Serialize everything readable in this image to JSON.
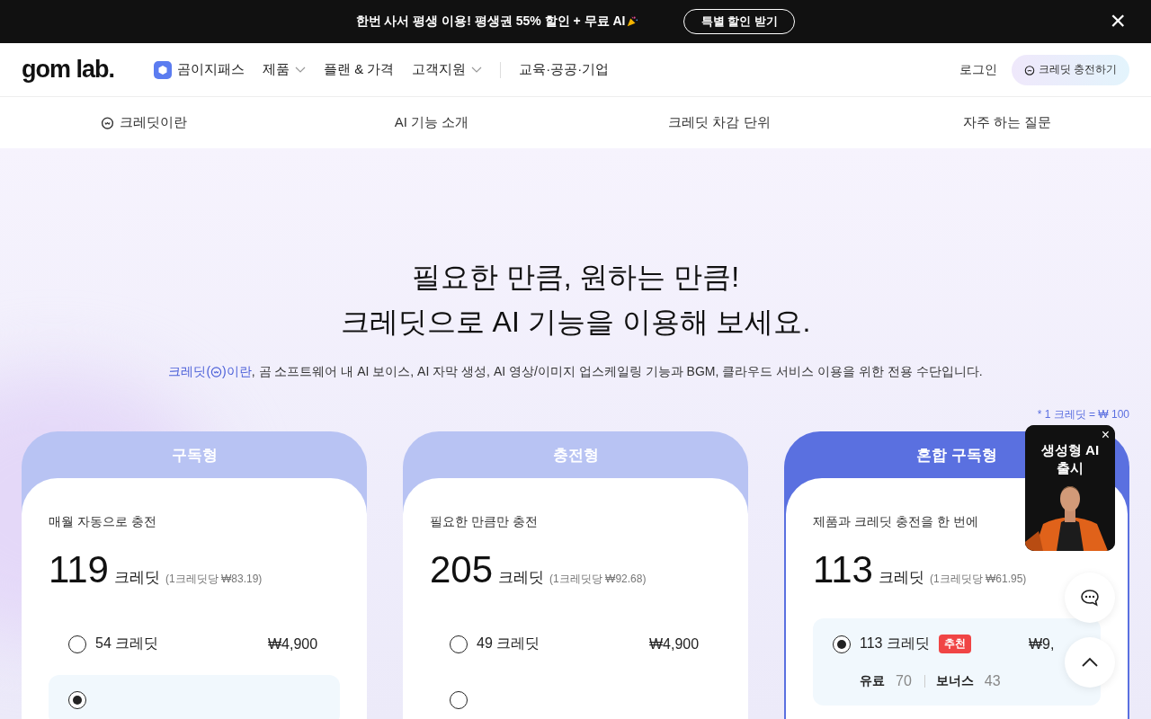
{
  "promo_bar": {
    "text": "한번 사서 평생 이용! 평생권 55% 할인 + 무료 AI",
    "button": "특별 할인 받기",
    "close": "×"
  },
  "nav": {
    "logo": "gom lab.",
    "items": [
      {
        "label": "곰이지패스",
        "kind": "pass"
      },
      {
        "label": "제품",
        "kind": "dropdown"
      },
      {
        "label": "플랜 & 가격",
        "kind": "plain"
      },
      {
        "label": "고객지원",
        "kind": "dropdown"
      },
      {
        "label": "교육·공공·기업",
        "kind": "divided"
      }
    ],
    "login": "로그인",
    "charge_button": "크레딧 충전하기"
  },
  "subnav": [
    {
      "label": "크레딧이란",
      "icon": true
    },
    {
      "label": "AI 기능 소개",
      "icon": false
    },
    {
      "label": "크레딧 차감 단위",
      "icon": false
    },
    {
      "label": "자주 하는 질문",
      "icon": false
    }
  ],
  "hero": {
    "title_lines": [
      "필요한 만큼, 원하는 만큼!",
      "크레딧으로 AI 기능을 이용해 보세요."
    ],
    "link_before": "크레딧(",
    "link_after": ")이란",
    "description": ", 곰 소프트웨어 내 AI 보이스, AI 자막 생성, AI 영상/이미지 업스케일링 기능과 BGM, 클라우드 서비스 이용을 위한 전용 수단입니다.",
    "note": "* 1 크레딧 = ₩ 100"
  },
  "plans": [
    {
      "title": "구독형",
      "selected": false,
      "subtitle": "매월 자동으로 충전",
      "amount": "119",
      "unit": "크레딧",
      "per": "(1크레딧당 ₩83.19)",
      "options": [
        {
          "label": "54 크레딧",
          "price": "₩4,900",
          "selected": false
        },
        {
          "selected": true
        }
      ]
    },
    {
      "title": "충전형",
      "selected": false,
      "subtitle": "필요한 만큼만 충전",
      "amount": "205",
      "unit": "크레딧",
      "per": "(1크레딧당 ₩92.68)",
      "options": [
        {
          "label": "49 크레딧",
          "price": "₩4,900",
          "selected": false
        },
        {
          "selected": false
        }
      ]
    },
    {
      "title": "혼합 구독형",
      "selected": true,
      "subtitle": "제품과 크레딧 충전을 한 번에",
      "amount": "113",
      "unit": "크레딧",
      "per": "(1크레딧당 ₩61.95)",
      "options": [
        {
          "label": "113 크레딧",
          "badge": "추천",
          "price": "₩9,",
          "selected": true,
          "paid_label": "유료",
          "paid": "70",
          "bonus_label": "보너스",
          "bonus": "43"
        }
      ]
    }
  ],
  "popup": {
    "title": "생성형 AI 출시",
    "close": "×"
  }
}
